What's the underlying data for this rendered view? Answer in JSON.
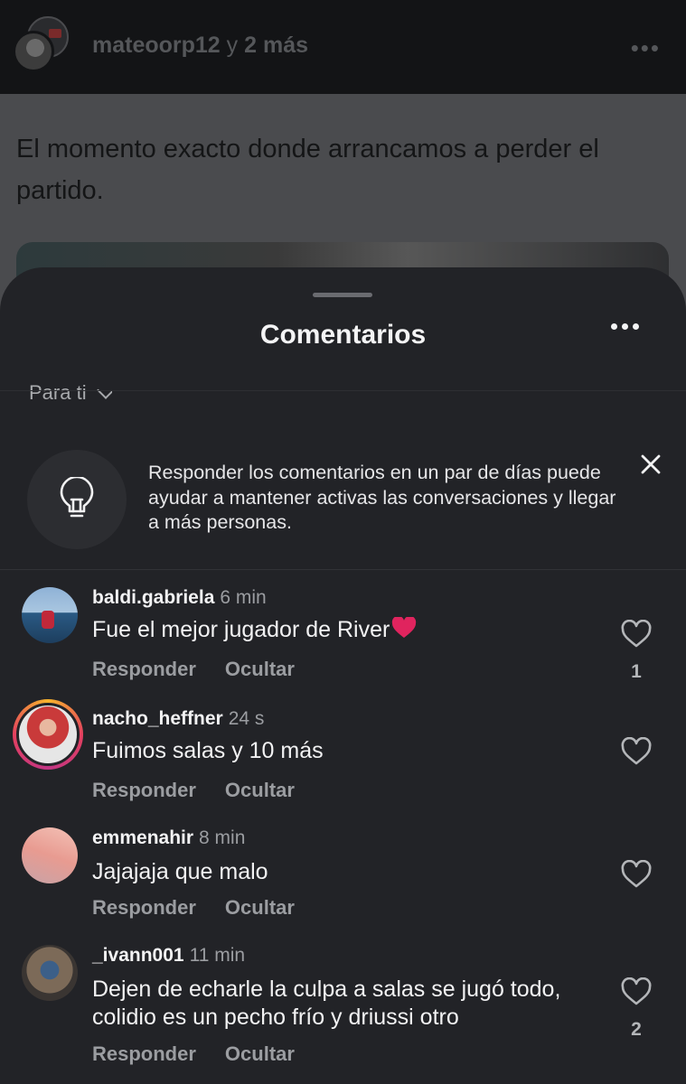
{
  "post": {
    "author": "mateoorp12",
    "conjunction": "y",
    "others": "2 más",
    "caption": "El momento exacto donde arrancamos a perder el partido."
  },
  "sheet": {
    "title": "Comentarios",
    "sort_label": "Para ti"
  },
  "tip": {
    "text": "Responder los comentarios en un par de días puede ayudar a mantener activas las conversaciones y llegar a más personas."
  },
  "comments": [
    {
      "user": "baldi.gabriela",
      "time": "6 min",
      "text": "Fue el mejor jugador de River",
      "emoji": "red-heart",
      "reply": "Responder",
      "hide": "Ocultar",
      "likes": "1"
    },
    {
      "user": "nacho_heffner",
      "time": "24 s",
      "text": "Fuimos salas y 10 más",
      "reply": "Responder",
      "hide": "Ocultar",
      "likes": ""
    },
    {
      "user": "emmenahir",
      "time": "8 min",
      "text": "Jajajaja que malo",
      "reply": "Responder",
      "hide": "Ocultar",
      "likes": ""
    },
    {
      "user": "_ivann001",
      "time": "11 min",
      "text": "Dejen de echarle la culpa a salas se jugó todo, colidio es un pecho frío y driussi otro",
      "reply": "Responder",
      "hide": "Ocultar",
      "likes": "2"
    }
  ],
  "icons": {
    "tip": "lightbulb-icon",
    "close": "close-icon",
    "like": "heart-outline-icon",
    "more": "more-horizontal-icon",
    "sort": "chevron-down-icon"
  },
  "colors": {
    "sheet_bg": "#222327",
    "text": "#f2f2f3",
    "muted": "#9b9da1",
    "emoji_heart": "#e0245e"
  }
}
